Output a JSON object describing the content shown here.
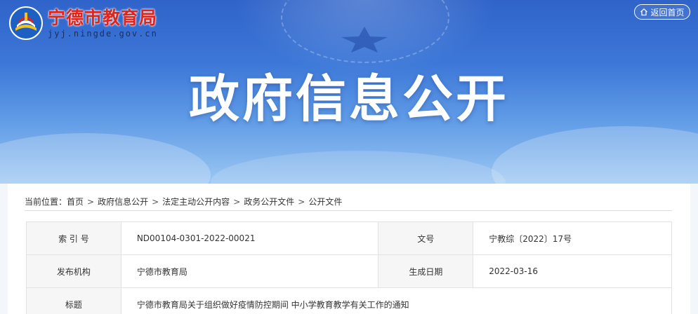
{
  "header": {
    "site_name": "宁德市教育局",
    "site_url": "jyj.ningde.gov.cn",
    "home_button": "返回首页",
    "banner_title": "政府信息公开"
  },
  "breadcrumb": {
    "prefix": "当前位置：",
    "items": [
      "首页",
      "政府信息公开",
      "法定主动公开内容",
      "政务公开文件",
      "公开文件"
    ]
  },
  "info_table": {
    "index_label": "索 引 号",
    "index_value": "ND00104-0301-2022-00021",
    "doc_no_label": "文号",
    "doc_no_value": "宁教综〔2022〕17号",
    "publisher_label": "发布机构",
    "publisher_value": "宁德市教育局",
    "date_label": "生成日期",
    "date_value": "2022-03-16",
    "title_label": "标题",
    "title_value": "宁德市教育局关于组织做好疫情防控期间 中小学教育教学有关工作的通知"
  },
  "colors": {
    "site_name": "#e0231b",
    "banner_top": "#2f63c9",
    "banner_bottom": "#9cc7f2"
  }
}
